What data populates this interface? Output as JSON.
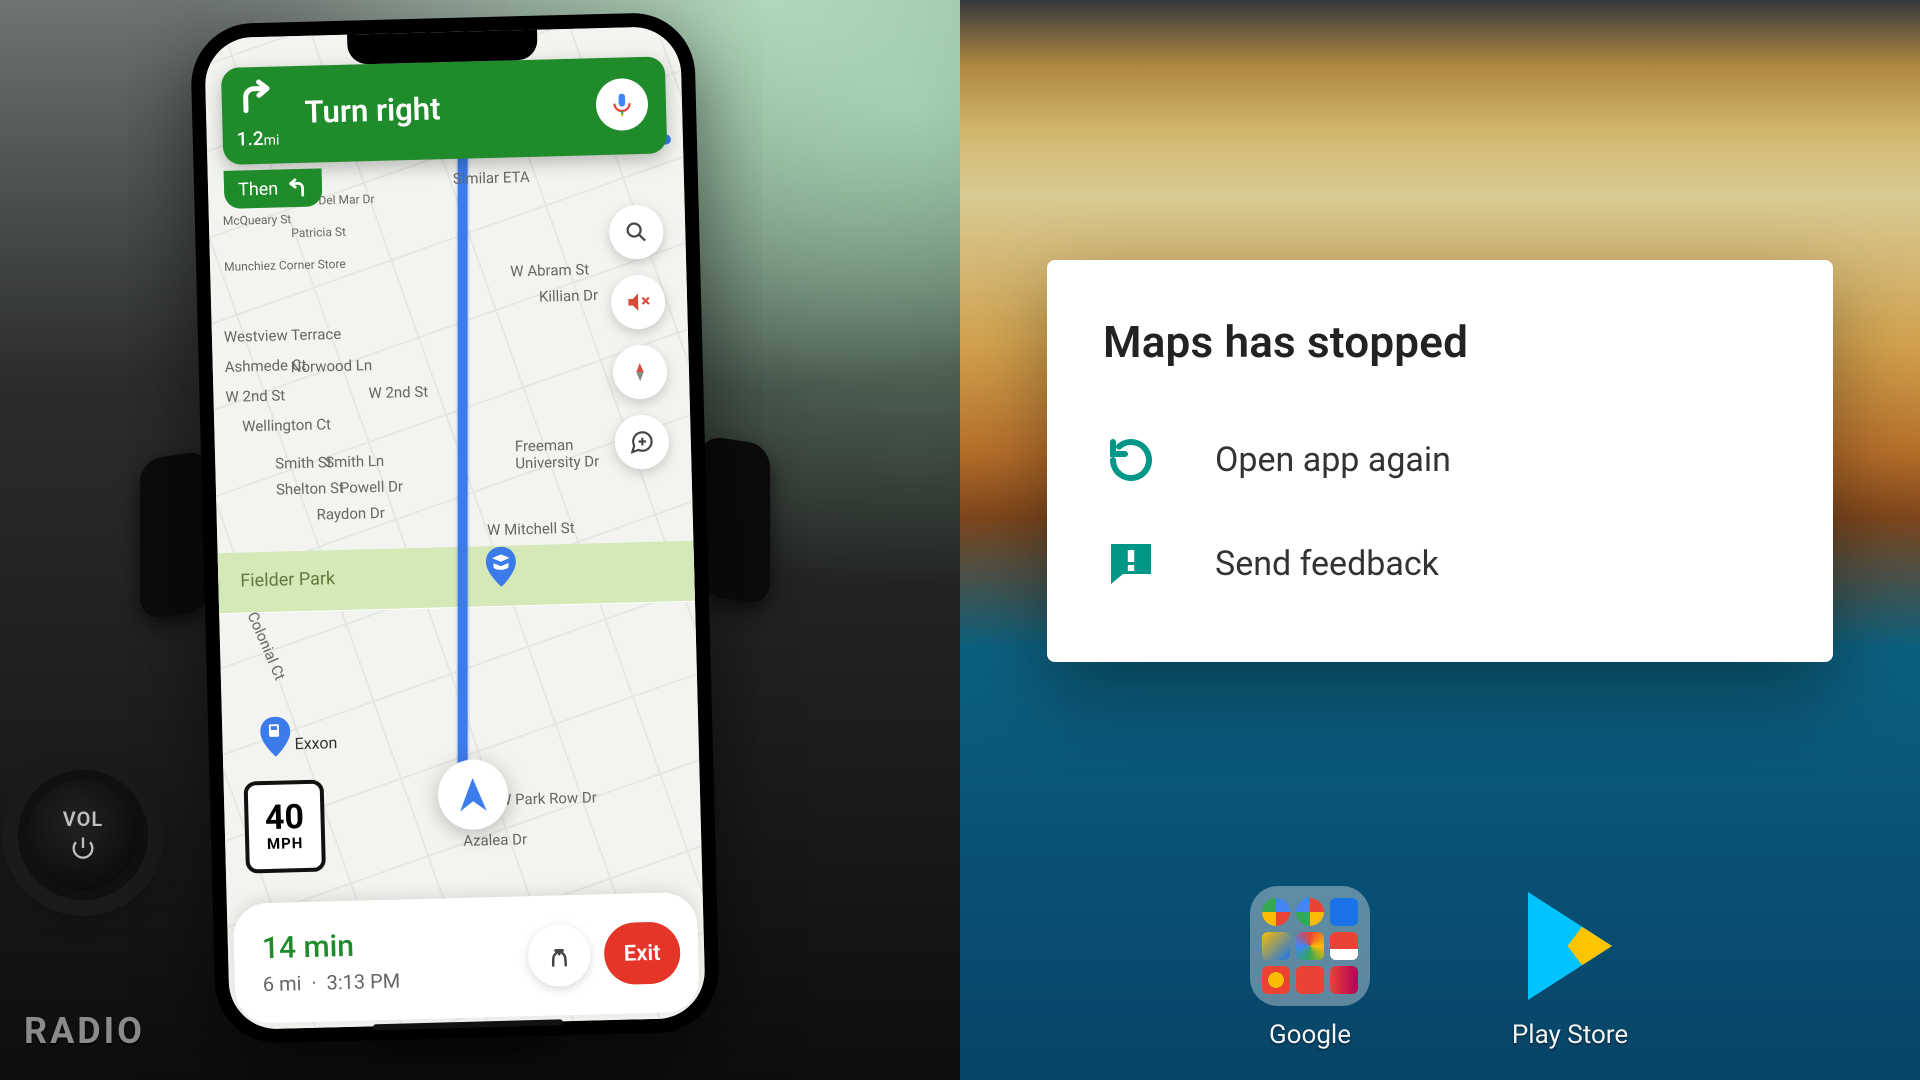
{
  "left": {
    "knob_label": "VOL",
    "radio_label": "RADIO",
    "nav": {
      "distance_value": "1.2",
      "distance_unit": "mi",
      "instruction": "Turn right",
      "then_label": "Then",
      "alt_route_note": "Similar ETA"
    },
    "speed_sign": {
      "value": "40",
      "unit": "MPH"
    },
    "eta": {
      "duration": "14 min",
      "distance": "6 mi",
      "arrival": "3:13 PM",
      "exit_label": "Exit"
    },
    "park_label": "Fielder Park",
    "gas_label": "Exxon",
    "streets": {
      "similar_eta": "Similar ETA",
      "w_abram": "W Abram St",
      "killian": "Killian Dr",
      "westview": "Westview Terrace",
      "ashmede": "Ashmede Ct",
      "norwood": "Norwood Ln",
      "w2nd_a": "W 2nd St",
      "w2nd_b": "W 2nd St",
      "wellington": "Wellington Ct",
      "smith_st": "Smith St",
      "smith_ln": "Smith Ln",
      "shelton": "Shelton St",
      "powell": "Powell Dr",
      "raydon": "Raydon Dr",
      "mitchell": "W Mitchell St",
      "freeman": "Freeman University Dr",
      "colonial": "Colonial Ct",
      "parkrow": "W Park Row Dr",
      "azalea": "Azalea Dr",
      "munchiez": "Munchiez Corner Store",
      "patricia": "Patricia St",
      "delmar": "Del Mar Dr",
      "mcqueary": "McQueary St"
    }
  },
  "right": {
    "dialog": {
      "title": "Maps has stopped",
      "open_again": "Open app again",
      "send_feedback": "Send feedback"
    },
    "dock": {
      "google_label": "Google",
      "playstore_label": "Play Store"
    }
  }
}
